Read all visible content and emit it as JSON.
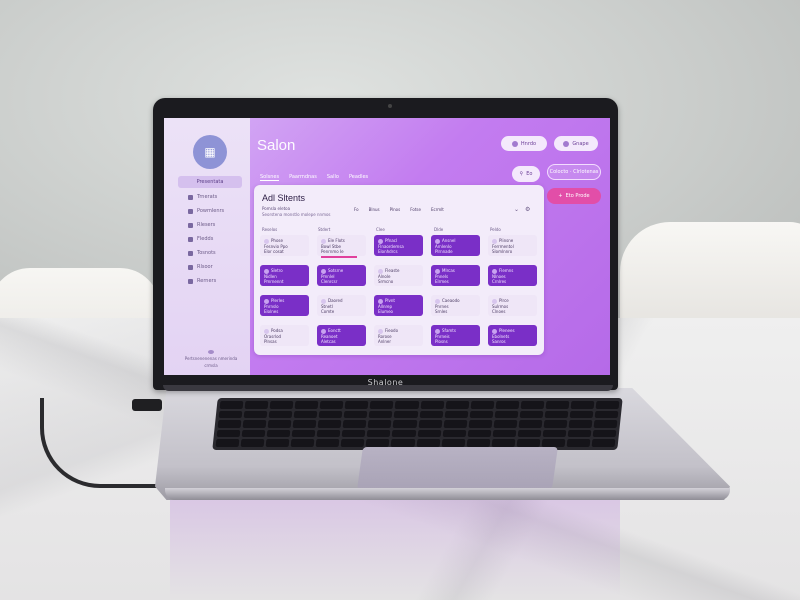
{
  "app": {
    "title": "Salon",
    "laptop_label": "Shalone"
  },
  "sidebar": {
    "logo_icon": "calendar-icon",
    "active_item": "Presentata",
    "items": [
      {
        "label": "Trnerats",
        "icon": "calendar-icon"
      },
      {
        "label": "Powmlenrs",
        "icon": "scissors-icon"
      },
      {
        "label": "Rlesers",
        "icon": "user-icon"
      },
      {
        "label": "Fledds",
        "icon": "clock-icon"
      },
      {
        "label": "Tosnots",
        "icon": "chart-icon"
      },
      {
        "label": "Rlsoor",
        "icon": "settings-icon"
      },
      {
        "label": "Rerners",
        "icon": "logout-icon"
      }
    ],
    "footer": {
      "line1": "Pertsnenenenas nmerinda",
      "line2": "crmsla"
    }
  },
  "header": {
    "buttons": [
      {
        "label": "Hnrdo",
        "icon": "bell-icon"
      },
      {
        "label": "Gnape",
        "icon": "user-icon"
      }
    ],
    "side_buttons": [
      {
        "label": "Eo",
        "icon": "filter-icon"
      },
      {
        "label": "Colocto · Clrlotenas",
        "icon": "search-icon"
      },
      {
        "label": "Eto Prode",
        "icon": "plus-icon"
      }
    ]
  },
  "tabs": [
    "Solsnes",
    "Paarmdnas",
    "Sallo",
    "Peadles"
  ],
  "panel": {
    "title": "Adl Sltents",
    "subtitle": "Pomsla eletoa",
    "description": "Seorstena monstlo molepe nnmos",
    "filters": [
      "Fo",
      "Blnus",
      "Plnos",
      "Fotse",
      "Ecrmlt"
    ],
    "columns": [
      "Reselos",
      "Stdert",
      "Clee",
      "Dlde",
      "Peldo"
    ],
    "rows": [
      [
        {
          "style": "light",
          "title": "Phose",
          "lines": [
            "Fesnvio Ppo",
            "Elor cosat"
          ]
        },
        {
          "style": "light",
          "title": "Ele Flots",
          "lines": [
            "Bowl Stbe",
            "Penrnmo Ie"
          ],
          "accent": true
        },
        {
          "style": "dark",
          "title": "Pfnacl",
          "lines": [
            "Flnaordemsa",
            "Elonhdrcs"
          ]
        },
        {
          "style": "dark",
          "title": "Ansnel",
          "lines": [
            "Arnlenlo",
            "Plrnnade"
          ]
        },
        {
          "style": "light",
          "title": "Plinsne",
          "lines": [
            "Ferrmentol",
            "Slomlnnro"
          ]
        }
      ],
      [
        {
          "style": "dark",
          "title": "Sletro",
          "lines": [
            "Nidlen",
            "Pmrnennt"
          ]
        },
        {
          "style": "dark",
          "title": "Sotsrne",
          "lines": [
            "Pmnlel",
            "Clenrcsr"
          ]
        },
        {
          "style": "light",
          "title": "Fleaste",
          "lines": [
            "Alnole",
            "Srmcno"
          ]
        },
        {
          "style": "dark",
          "title": "Mlrcas",
          "lines": [
            "Pnnels",
            "Elrmes"
          ]
        },
        {
          "style": "dark",
          "title": "Flemns",
          "lines": [
            "Nlnoes",
            "Crnlres"
          ]
        }
      ],
      [
        {
          "style": "dark",
          "title": "Plerles",
          "lines": [
            "Pnrnslo",
            "Elolnes"
          ]
        },
        {
          "style": "light",
          "title": "Daored",
          "lines": [
            "Stnetl",
            "Comte"
          ]
        },
        {
          "style": "dark",
          "title": "Plvnt",
          "lines": [
            "Allnrep",
            "Elumeo"
          ]
        },
        {
          "style": "light",
          "title": "Caeaodo",
          "lines": [
            "Pnrnes",
            "Srnles"
          ]
        },
        {
          "style": "light",
          "title": "Plrce",
          "lines": [
            "Sulrmos",
            "Clnoes"
          ]
        }
      ],
      [
        {
          "style": "light",
          "title": "Podsa",
          "lines": [
            "Orasrlod",
            "Plnsas"
          ]
        },
        {
          "style": "dark",
          "title": "Eonctt",
          "lines": [
            "Reanoet",
            "Aletcas"
          ]
        },
        {
          "style": "light",
          "title": "Fieodo",
          "lines": [
            "Rorose",
            "Anlner"
          ]
        },
        {
          "style": "dark",
          "title": "Sfamts",
          "lines": [
            "Pnrneis",
            "Plosns"
          ]
        },
        {
          "style": "dark",
          "title": "Plenees",
          "lines": [
            "Ebolnets",
            "Sanros"
          ]
        }
      ]
    ]
  },
  "colors": {
    "accent": "#7a2fc7",
    "screen_bg": "#c37cf0",
    "highlight": "#e0409c"
  }
}
